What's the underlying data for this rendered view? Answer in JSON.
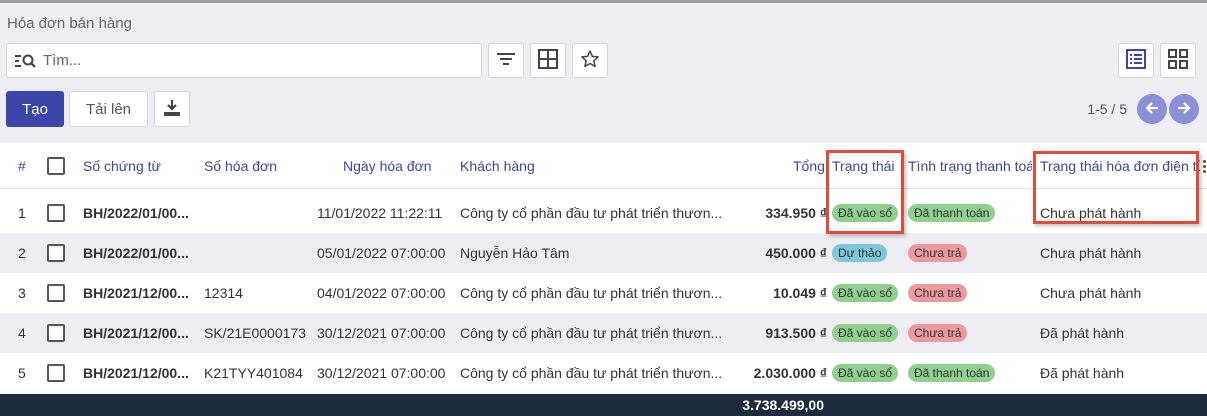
{
  "breadcrumb": "Hóa đơn bán hàng",
  "search": {
    "placeholder": "Tìm..."
  },
  "toolbar": {
    "create_label": "Tạo",
    "upload_label": "Tải lên"
  },
  "pager": {
    "range": "1-5 / 5"
  },
  "table": {
    "headers": {
      "index": "#",
      "voucher_no": "Số chứng từ",
      "invoice_no": "Số hóa đơn",
      "invoice_date": "Ngày hóa đơn",
      "customer": "Khách hàng",
      "total": "Tổng",
      "status": "Trạng thái",
      "payment_status": "Tình trạng thanh toán",
      "einvoice_status": "Trạng thái hóa đơn điện tử"
    },
    "rows": [
      {
        "index": "1",
        "voucher_no": "BH/2022/01/00...",
        "invoice_no": "",
        "invoice_date": "11/01/2022 11:22:11",
        "customer": "Công ty cổ phần đầu tư phát triển thươn...",
        "total": "334.950 ₫",
        "status": "Đã vào sổ",
        "payment_status": "Đã thanh toán",
        "einvoice_status": "Chưa phát hành"
      },
      {
        "index": "2",
        "voucher_no": "BH/2022/01/00...",
        "invoice_no": "",
        "invoice_date": "05/01/2022 07:00:00",
        "customer": "Nguyễn Hảo Tâm",
        "total": "450.000 ₫",
        "status": "Dự thảo",
        "payment_status": "Chưa trả",
        "einvoice_status": "Chưa phát hành"
      },
      {
        "index": "3",
        "voucher_no": "BH/2021/12/00...",
        "invoice_no": "12314",
        "invoice_date": "04/01/2022 07:00:00",
        "customer": "Công ty cổ phần đầu tư phát triển thươn...",
        "total": "10.049 ₫",
        "status": "Đã vào sổ",
        "payment_status": "Chưa trả",
        "einvoice_status": "Chưa phát hành"
      },
      {
        "index": "4",
        "voucher_no": "BH/2021/12/00...",
        "invoice_no": "SK/21E0000173",
        "invoice_date": "30/12/2021 07:00:00",
        "customer": "Công ty cổ phần đầu tư phát triển thươn...",
        "total": "913.500 ₫",
        "status": "Đã vào sổ",
        "payment_status": "Chưa trả",
        "einvoice_status": "Đã phát hành"
      },
      {
        "index": "5",
        "voucher_no": "BH/2021/12/00...",
        "invoice_no": "K21TYY401084",
        "invoice_date": "30/12/2021 07:00:00",
        "customer": "Công ty cổ phần đầu tư phát triển thươn...",
        "total": "2.030.000 ₫",
        "status": "Đã vào sổ",
        "payment_status": "Đã thanh toán",
        "einvoice_status": "Đã phát hành"
      }
    ],
    "footer_total": "3.738.499,00"
  },
  "colors": {
    "primary": "#3b46a8",
    "badge_posted": "#8fd08e",
    "badge_draft": "#7ec8d9",
    "badge_unpaid": "#ec9aa0",
    "highlight_box": "#e14b3b"
  },
  "icons": [
    "search-list-icon",
    "filter-icon",
    "grid-icon",
    "star-icon",
    "download-icon",
    "list-view-icon",
    "kanban-view-icon",
    "arrow-left-icon",
    "arrow-right-icon",
    "column-options-icon"
  ]
}
